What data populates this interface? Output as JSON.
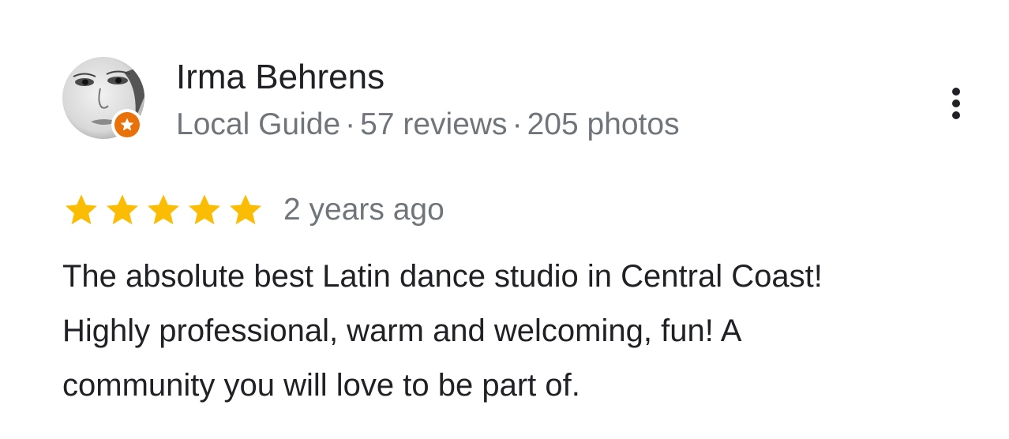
{
  "reviewer": {
    "name": "Irma Behrens",
    "badge": "Local Guide",
    "separator": "·",
    "reviews": "57 reviews",
    "photos": "205 photos",
    "avatar_icon": "person-photo-icon",
    "badge_icon": "local-guide-star-icon",
    "badge_color": "#e8710a"
  },
  "menu": {
    "icon": "more-vert-icon"
  },
  "review": {
    "rating": 5,
    "rating_max": 5,
    "star_color": "#fbbc04",
    "time": "2 years ago",
    "lines": [
      "The absolute best Latin dance studio in Central Coast!",
      "Highly professional, warm and welcoming, fun! A",
      "community you will love to be part of."
    ]
  }
}
